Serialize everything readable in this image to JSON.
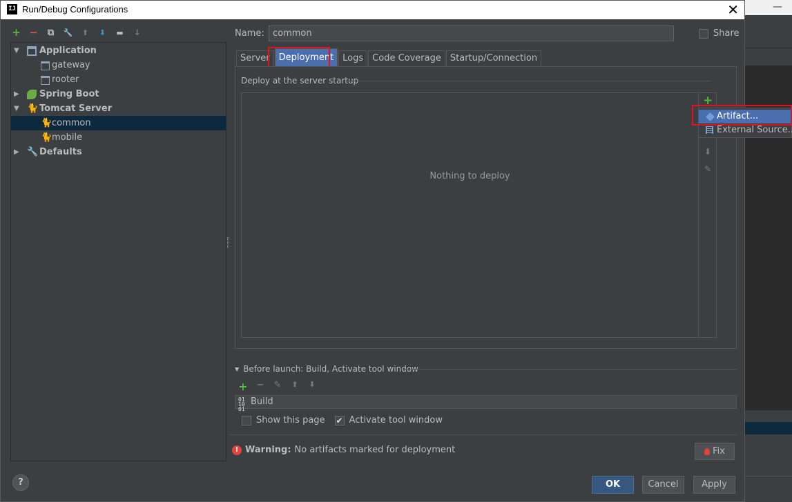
{
  "window": {
    "title": "Run/Debug Configurations",
    "close_glyph": "✕",
    "app_icon_text": "IJ"
  },
  "toolbar": {
    "add": "+",
    "remove": "−",
    "copy": "⧉",
    "edit_defaults": "🔧",
    "move_up": "⬆",
    "move_down": "⬇",
    "folder": "▬",
    "sort": "↓"
  },
  "tree": {
    "items": [
      {
        "label": "Application",
        "bold": true,
        "expanded": true
      },
      {
        "label": "gateway"
      },
      {
        "label": "rooter"
      },
      {
        "label": "Spring Boot",
        "bold": true,
        "expanded": false
      },
      {
        "label": "Tomcat Server",
        "bold": true,
        "expanded": true
      },
      {
        "label": "common",
        "selected": true
      },
      {
        "label": "mobile"
      },
      {
        "label": "Defaults",
        "bold": true,
        "expanded": false
      }
    ]
  },
  "form": {
    "name_label": "Name:",
    "name_value": "common",
    "share_label": "Share",
    "share_checked": false
  },
  "tabs": [
    {
      "label": "Server"
    },
    {
      "label": "Deployment",
      "active": true
    },
    {
      "label": "Logs"
    },
    {
      "label": "Code Coverage"
    },
    {
      "label": "Startup/Connection"
    }
  ],
  "deployment": {
    "section_title": "Deploy at the server startup",
    "empty_text": "Nothing to deploy",
    "side_tools": {
      "add": "+",
      "down": "⬇",
      "edit": "✎"
    }
  },
  "popup": {
    "items": [
      {
        "label": "Artifact...",
        "selected": true
      },
      {
        "label": "External Source..."
      }
    ]
  },
  "before_launch": {
    "title": "Before launch: Build, Activate tool window",
    "toolbar": {
      "add": "+",
      "remove": "−",
      "edit": "✎",
      "up": "⬆",
      "down": "⬇"
    },
    "items": [
      {
        "label": "Build",
        "icon_text": "01\n10\n01"
      }
    ],
    "show_page_label": "Show this page",
    "show_page_checked": false,
    "activate_label": "Activate tool window",
    "activate_checked": true
  },
  "warning": {
    "icon": "!",
    "title": "Warning:",
    "message": "No artifacts marked for deployment",
    "fix_label": "Fix"
  },
  "buttons": {
    "help": "?",
    "ok": "OK",
    "cancel": "Cancel",
    "apply": "Apply"
  },
  "colors": {
    "accent": "#4b6eaf",
    "highlight_outline": "#e0141e",
    "selection": "#0d293e"
  }
}
